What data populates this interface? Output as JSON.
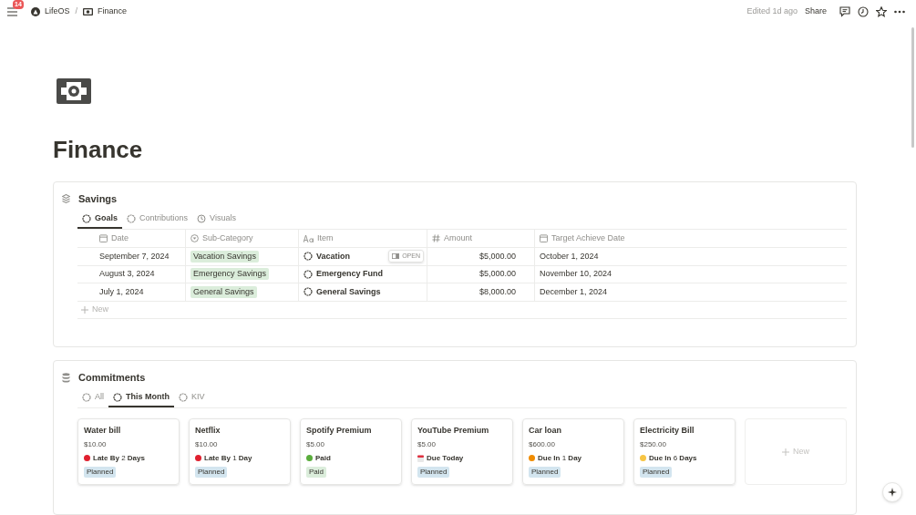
{
  "topbar": {
    "notification_count": "14",
    "breadcrumbs": [
      {
        "label": "LifeOS",
        "kind": "logo"
      },
      {
        "label": "Finance",
        "kind": "money"
      }
    ],
    "separator": "/",
    "edited": "Edited 1d ago",
    "share": "Share"
  },
  "page": {
    "title": "Finance"
  },
  "savings": {
    "title": "Savings",
    "tabs": [
      {
        "label": "Goals",
        "kind": "circle",
        "selected": true
      },
      {
        "label": "Contributions",
        "kind": "circle",
        "selected": false
      },
      {
        "label": "Visuals",
        "kind": "clock",
        "selected": false
      }
    ],
    "columns": [
      {
        "label": "Date",
        "kind": "calendar"
      },
      {
        "label": "Sub-Category",
        "kind": "select"
      },
      {
        "label": "Item",
        "kind": "text"
      },
      {
        "label": "Amount",
        "kind": "number"
      },
      {
        "label": "Target Achieve Date",
        "kind": "calendar"
      }
    ],
    "rows": [
      {
        "date": "September 7, 2024",
        "sub_category": "Vacation Savings",
        "item": "Vacation",
        "open_button": "OPEN",
        "amount": "$5,000.00",
        "target": "October 1, 2024"
      },
      {
        "date": "August 3, 2024",
        "sub_category": "Emergency Savings",
        "item": "Emergency Fund",
        "amount": "$5,000.00",
        "target": "November 10, 2024"
      },
      {
        "date": "July 1, 2024",
        "sub_category": "General Savings",
        "item": "General Savings",
        "amount": "$8,000.00",
        "target": "December 1, 2024"
      }
    ],
    "new_label": "New"
  },
  "commitments": {
    "title": "Commitments",
    "tabs": [
      {
        "label": "All",
        "selected": false
      },
      {
        "label": "This Month",
        "selected": true
      },
      {
        "label": "KIV",
        "selected": false
      }
    ],
    "cards": [
      {
        "title": "Water bill",
        "amount": "$10.00",
        "status": {
          "kind": "dot",
          "color": "#e0202f",
          "text": "**Late By** 2 **Days**"
        },
        "tag": {
          "label": "Planned",
          "color": "#d3e5ef"
        }
      },
      {
        "title": "Netflix",
        "amount": "$10.00",
        "status": {
          "kind": "dot",
          "color": "#e0202f",
          "text": "**Late By** 1 **Day**"
        },
        "tag": {
          "label": "Planned",
          "color": "#d3e5ef"
        }
      },
      {
        "title": "Spotify Premium",
        "amount": "$5.00",
        "status": {
          "kind": "dot",
          "color": "#5aad3c",
          "text": "**Paid**"
        },
        "tag": {
          "label": "Paid",
          "color": "#dbeddb"
        }
      },
      {
        "title": "YouTube Premium",
        "amount": "$5.00",
        "status": {
          "kind": "calendar",
          "text": "**Due Today**"
        },
        "tag": {
          "label": "Planned",
          "color": "#d3e5ef"
        }
      },
      {
        "title": "Car loan",
        "amount": "$600.00",
        "status": {
          "kind": "dot",
          "color": "#f08c00",
          "text": "**Due In** 1 **Day**"
        },
        "tag": {
          "label": "Planned",
          "color": "#d3e5ef"
        }
      },
      {
        "title": "Electricity Bill",
        "amount": "$250.00",
        "status": {
          "kind": "dot",
          "color": "#f7c544",
          "text": "**Due In** 6 **Days**"
        },
        "tag": {
          "label": "Planned",
          "color": "#d3e5ef"
        }
      }
    ],
    "new_label": "New"
  }
}
